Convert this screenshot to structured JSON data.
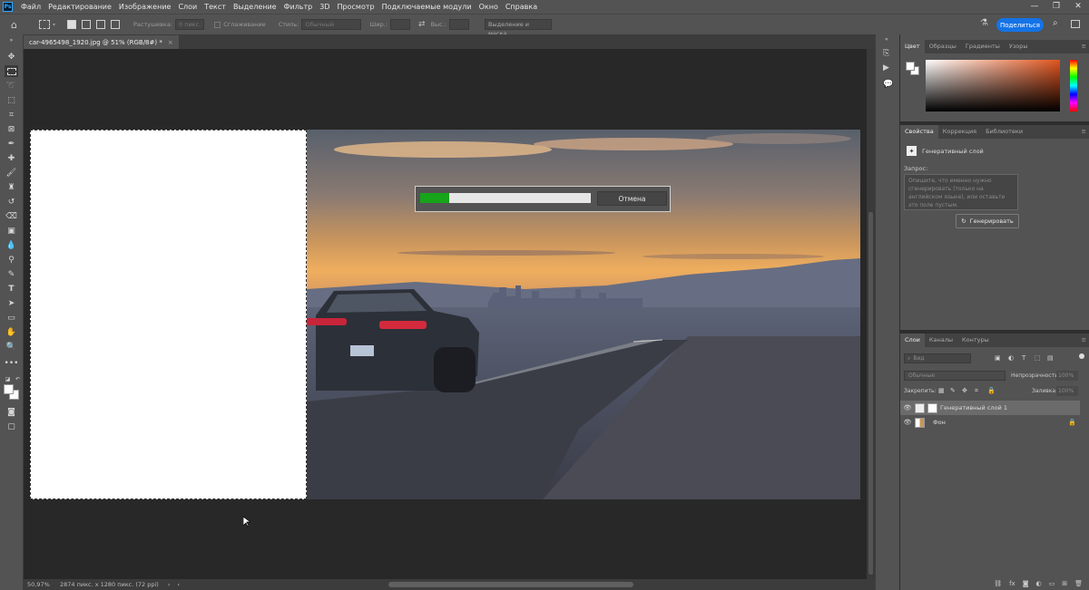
{
  "menu": {
    "items": [
      "Файл",
      "Редактирование",
      "Изображение",
      "Слои",
      "Текст",
      "Выделение",
      "Фильтр",
      "3D",
      "Просмотр",
      "Подключаемые модули",
      "Окно",
      "Справка"
    ]
  },
  "options": {
    "feather_label": "Растушевка:",
    "feather_value": "0 пикс.",
    "antialias_label": "Сглаживание",
    "style_label": "Стиль:",
    "style_value": "Обычный",
    "width_label": "Шир.:",
    "height_label": "Выс.:",
    "select_mask": "Выделение и маска...",
    "share": "Поделиться"
  },
  "document": {
    "tab_title": "car-4965498_1920.jpg @ 51% (RGB/8#) *",
    "close": "×"
  },
  "status": {
    "zoom": "50,97%",
    "info": "2874 пикс. x 1280 пикс. (72 ppi)"
  },
  "dialog": {
    "cancel": "Отмена",
    "progress": 0.17
  },
  "color_panel": {
    "tabs": [
      "Цвет",
      "Образцы",
      "Градиенты",
      "Узоры"
    ]
  },
  "properties_panel": {
    "tabs": [
      "Свойства",
      "Коррекция",
      "Библиотеки"
    ],
    "layer_type": "Генеративный слой",
    "prompt_label": "Запрос:",
    "prompt_placeholder": "Опишите, что именно нужно сгенерировать (только на английском языке), или оставьте это поле пустым.",
    "generate": "Генерировать"
  },
  "layers_panel": {
    "tabs": [
      "Слои",
      "Каналы",
      "Контуры"
    ],
    "search_placeholder": "Вид",
    "blend_mode": "Обычные",
    "opacity_label": "Непрозрачность:",
    "opacity_value": "100%",
    "lock_label": "Закрепить:",
    "fill_label": "Заливка:",
    "fill_value": "100%",
    "layers": [
      {
        "name": "Генеративный слой 1"
      },
      {
        "name": "Фон"
      }
    ]
  },
  "colors": {
    "accent": "#1473e6",
    "progress": "#17a31a",
    "panel": "#535353",
    "canvas": "#282828"
  }
}
